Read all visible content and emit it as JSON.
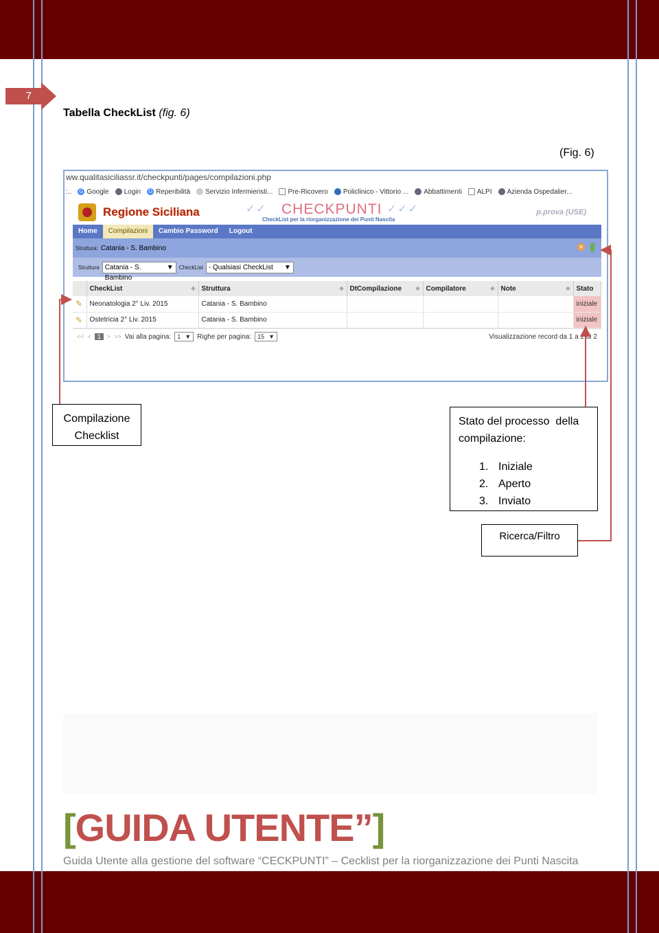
{
  "page": {
    "number": "7",
    "heading_bold": "Tabella CheckList",
    "heading_italic": "(fig. 6)",
    "fig_caption": "(Fig. 6)"
  },
  "screenshot": {
    "url": "ww.qualitasiciliassr.it/checkpunti/pages/compilazioni.php",
    "bookmarks": [
      "Google",
      "Login",
      "Reperibilità",
      "Servizio Infermieristi...",
      "Pre-Ricovero",
      "Policlinico - Vittorio ...",
      "Abbattimenti",
      "ALPI",
      "Azienda Ospedalier..."
    ],
    "brand": "Regione Siciliana",
    "app_title": "CHECKPUNTI",
    "app_subtitle": "CheckList per la riorganizzazione dei Punti Nascita",
    "user": "p.prova (USE)",
    "nav": [
      "Home",
      "Compilazioni",
      "Cambio Password",
      "Logout"
    ],
    "struct_label": "Struttura:",
    "struct_value": "Catania - S. Bambino",
    "filter": {
      "struttura_label": "Struttura",
      "struttura_value": "Catania - S. Bambino",
      "checklist_label": "CheckList",
      "checklist_value": "- Qualsiasi CheckList"
    },
    "table": {
      "columns": [
        "CheckList",
        "Struttura",
        "DtCompilazione",
        "Compilatore",
        "Note",
        "Stato"
      ],
      "rows": [
        [
          "Neonatologia 2° Liv. 2015",
          "Catania - S. Bambino",
          "",
          "",
          "",
          "iniziale"
        ],
        [
          "Ostetricia 2° Liv. 2015",
          "Catania - S. Bambino",
          "",
          "",
          "",
          "iniziale"
        ]
      ]
    },
    "pager": {
      "first": "<<",
      "prev": "<",
      "current": "1",
      "next": ">",
      "last": ">>",
      "goto_label": "Vai alla pagina:",
      "goto_value": "1",
      "rows_label": "Righe per pagina:",
      "rows_value": "15",
      "record_text": "Visualizzazione record da 1 a 2 di 2"
    }
  },
  "callouts": {
    "compilazione_line1": "Compilazione",
    "compilazione_line2": "Checklist",
    "stato_line1": "Stato del processo  della",
    "stato_line2": "compilazione:",
    "stato_items": [
      {
        "n": "1.",
        "label": "Iniziale"
      },
      {
        "n": "2.",
        "label": "Aperto"
      },
      {
        "n": "3.",
        "label": "Inviato"
      }
    ],
    "ricerca": "Ricerca/Filtro"
  },
  "footer": {
    "bracket_open": "[",
    "title": "GUIDA UTENTE”",
    "bracket_close": "]",
    "subtitle": "Guida Utente alla gestione del software “CECKPUNTI” – Cecklist per la riorganizzazione dei Punti Nascita"
  },
  "colors": {
    "band": "#660000",
    "accent": "#c0504d",
    "bracket": "#77933c",
    "arrow": "#c0504d"
  }
}
